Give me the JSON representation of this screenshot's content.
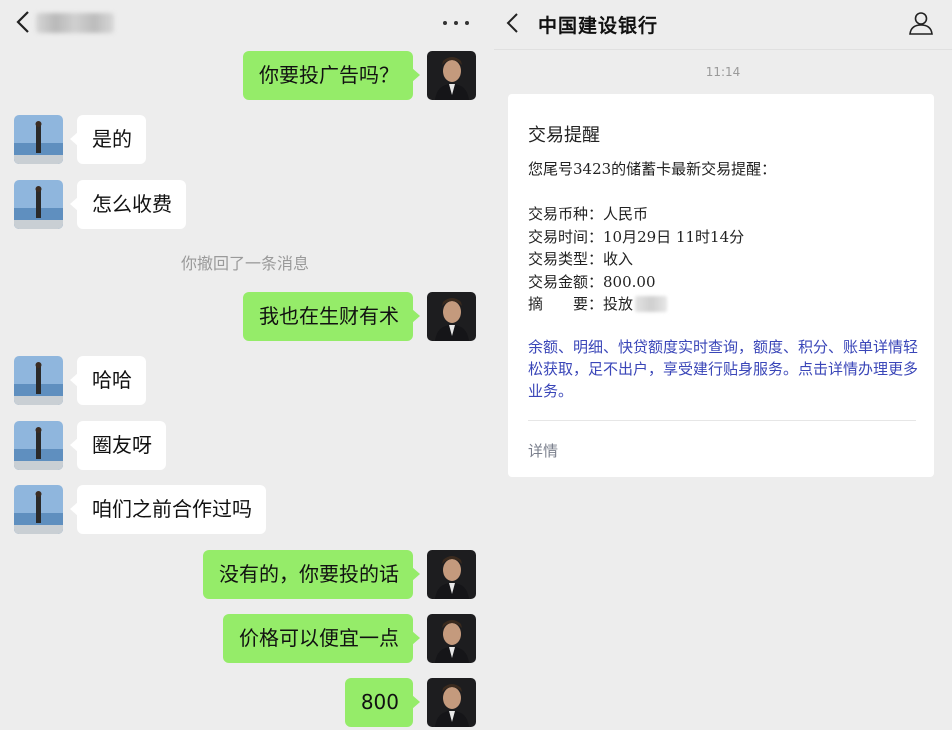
{
  "left": {
    "header_more": "more-icon",
    "recalled_notice": "你撤回了一条消息",
    "messages": [
      {
        "dir": "out",
        "text": "你要投广告吗？"
      },
      {
        "dir": "in",
        "text": "是的"
      },
      {
        "dir": "in",
        "text": "怎么收费"
      },
      {
        "dir": "out",
        "text": "我也在生财有术"
      },
      {
        "dir": "in",
        "text": "哈哈"
      },
      {
        "dir": "in",
        "text": "圈友呀"
      },
      {
        "dir": "in",
        "text": "咱们之前合作过吗"
      },
      {
        "dir": "out",
        "text": "没有的，你要投的话"
      },
      {
        "dir": "out",
        "text": "价格可以便宜一点"
      },
      {
        "dir": "out",
        "text": "800"
      }
    ]
  },
  "right": {
    "title": "中国建设银行",
    "time": "11:14",
    "card": {
      "title": "交易提醒",
      "intro": "您尾号3423的储蓄卡最新交易提醒：",
      "currency": "交易币种：人民币",
      "trade_time": "交易时间：10月29日 11时14分",
      "trade_type": "交易类型：收入",
      "amount": "交易金额：800.00",
      "summary": "摘　　要：投放",
      "promo": "余额、明细、快贷额度实时查询，额度、积分、账单详情轻松获取，足不出户，享受建行贴身服务。点击详情办理更多业务。",
      "details_link": "详情"
    }
  },
  "colors": {
    "chat_bg": "#ededed",
    "outgoing_bubble": "#95ec69",
    "incoming_bubble": "#ffffff",
    "promo_text": "#3a46b8"
  }
}
